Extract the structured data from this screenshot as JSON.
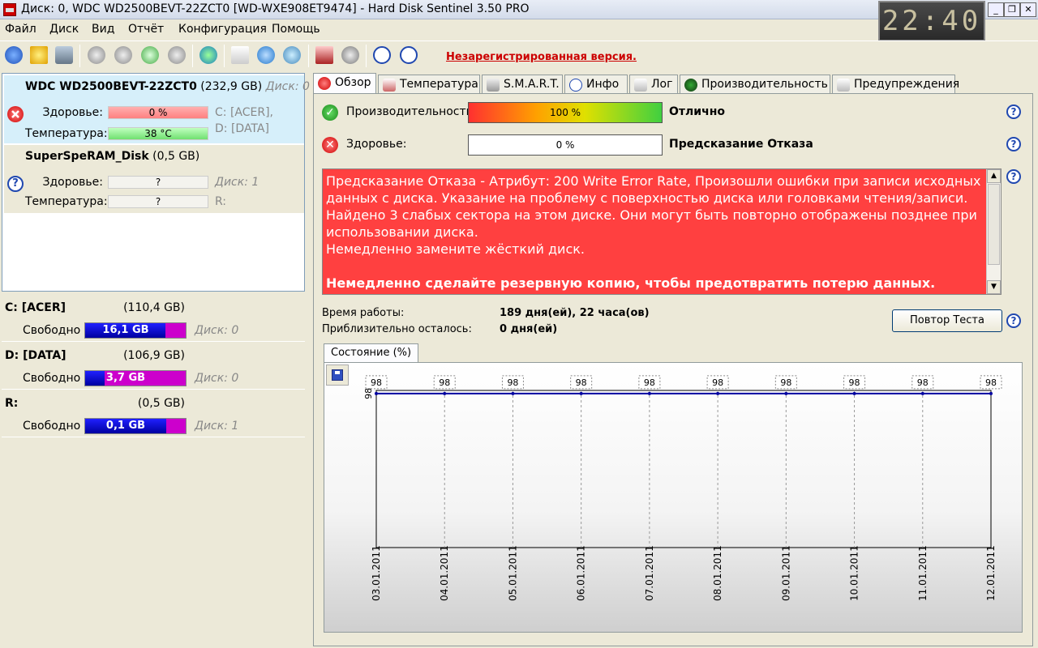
{
  "window": {
    "title": "Диск: 0, WDC WD2500BEVT-22ZCT0 [WD-WXE908ET9474]  -  Hard Disk Sentinel 3.50 PRO",
    "clock": "22:40"
  },
  "menu": [
    "Файл",
    "Диск",
    "Вид",
    "Отчёт",
    "Конфигурация",
    "Помощь"
  ],
  "toolbar": {
    "unregistered": "Незарегистрированная версия."
  },
  "disks": [
    {
      "model": "WDC WD2500BEVT-22ZCT0",
      "size": "(232,9 GB)",
      "disk_label": "Диск: 0",
      "status": "error",
      "health_label": "Здоровье:",
      "health_value": "0 %",
      "temp_label": "Температура:",
      "temp_value": "38 °C",
      "vol1": "C: [ACER],",
      "vol2": "D: [DATA]"
    },
    {
      "model": "SuperSpeRAM_Disk",
      "size": "(0,5 GB)",
      "disk_label": "Диск: 1",
      "status": "unknown",
      "health_label": "Здоровье:",
      "health_value": "?",
      "temp_label": "Температура:",
      "temp_value": "?",
      "vol1": "R:"
    }
  ],
  "volumes": [
    {
      "name": "C: [ACER]",
      "size": "(110,4 GB)",
      "free_label": "Свободно",
      "free": "16,1 GB",
      "free_fraction": 0.146,
      "disk": "Диск: 0"
    },
    {
      "name": "D: [DATA]",
      "size": "(106,9 GB)",
      "free_label": "Свободно",
      "free": "3,7 GB",
      "free_fraction": 0.035,
      "disk": "Диск: 0"
    },
    {
      "name": "R:",
      "size": "(0,5 GB)",
      "free_label": "Свободно",
      "free": "0,1 GB",
      "free_fraction": 0.2,
      "disk": "Диск: 1"
    }
  ],
  "tabs": [
    "Обзор",
    "Температура",
    "S.M.A.R.T.",
    "Инфо",
    "Лог",
    "Производительность",
    "Предупреждения"
  ],
  "overview": {
    "performance_label": "Производительность",
    "performance_value": "100 %",
    "performance_verdict": "Отлично",
    "health_label": "Здоровье:",
    "health_value": "0 %",
    "health_verdict": "Предсказание Отказа",
    "alert_lines": [
      "Предсказание Отказа - Атрибут: 200 Write Error Rate, Произошли ошибки при записи исходных данных с диска. Указание на проблему с поверхностью диска или головками чтения/записи.",
      "Найдено 3 слабых сектора на этом диске. Они могут быть повторно отображены позднее при использовании диска.",
      "Немедленно замените жёсткий диск."
    ],
    "alert_strong": "Немедленно сделайте резервную копию, чтобы предотвратить потерю данных.",
    "uptime_label": "Время работы:",
    "uptime_value": "189 дня(ей), 22 часа(ов)",
    "remaining_label": "Приблизительно осталось:",
    "remaining_value": "0 дня(ей)",
    "retest_button": "Повтор Теста",
    "chart_tab": "Состояние (%)"
  },
  "chart_data": {
    "type": "line",
    "x": [
      "03.01.2011",
      "04.01.2011",
      "05.01.2011",
      "06.01.2011",
      "07.01.2011",
      "08.01.2011",
      "09.01.2011",
      "10.01.2011",
      "11.01.2011",
      "12.01.2011"
    ],
    "series": [
      {
        "values": [
          98,
          98,
          98,
          98,
          98,
          98,
          98,
          98,
          98,
          98
        ]
      }
    ],
    "y_tick": "98",
    "ylim": [
      0,
      100
    ],
    "grid": true,
    "line_color": "#0000a0"
  }
}
